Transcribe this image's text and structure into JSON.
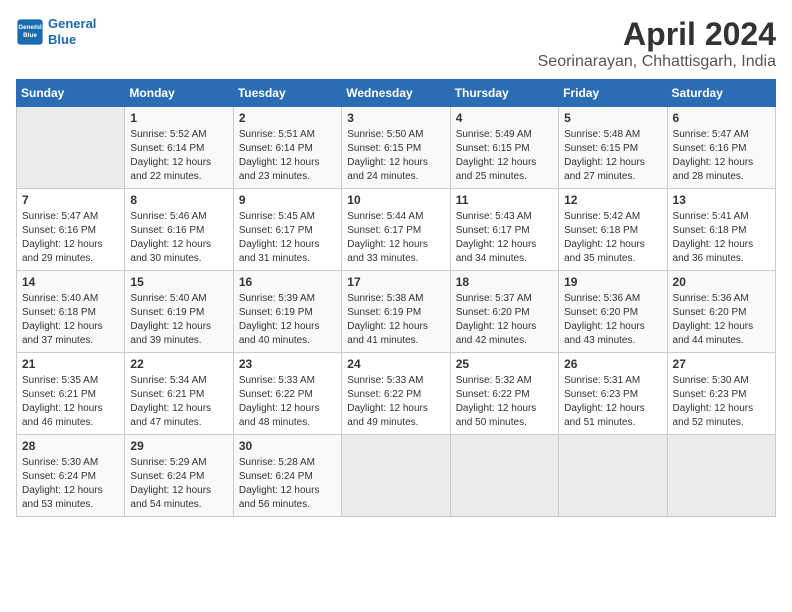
{
  "header": {
    "logo_line1": "General",
    "logo_line2": "Blue",
    "title": "April 2024",
    "subtitle": "Seorinarayan, Chhattisgarh, India"
  },
  "weekdays": [
    "Sunday",
    "Monday",
    "Tuesday",
    "Wednesday",
    "Thursday",
    "Friday",
    "Saturday"
  ],
  "weeks": [
    [
      {
        "day": "",
        "sunrise": "",
        "sunset": "",
        "daylight": ""
      },
      {
        "day": "1",
        "sunrise": "Sunrise: 5:52 AM",
        "sunset": "Sunset: 6:14 PM",
        "daylight": "Daylight: 12 hours and 22 minutes."
      },
      {
        "day": "2",
        "sunrise": "Sunrise: 5:51 AM",
        "sunset": "Sunset: 6:14 PM",
        "daylight": "Daylight: 12 hours and 23 minutes."
      },
      {
        "day": "3",
        "sunrise": "Sunrise: 5:50 AM",
        "sunset": "Sunset: 6:15 PM",
        "daylight": "Daylight: 12 hours and 24 minutes."
      },
      {
        "day": "4",
        "sunrise": "Sunrise: 5:49 AM",
        "sunset": "Sunset: 6:15 PM",
        "daylight": "Daylight: 12 hours and 25 minutes."
      },
      {
        "day": "5",
        "sunrise": "Sunrise: 5:48 AM",
        "sunset": "Sunset: 6:15 PM",
        "daylight": "Daylight: 12 hours and 27 minutes."
      },
      {
        "day": "6",
        "sunrise": "Sunrise: 5:47 AM",
        "sunset": "Sunset: 6:16 PM",
        "daylight": "Daylight: 12 hours and 28 minutes."
      }
    ],
    [
      {
        "day": "7",
        "sunrise": "Sunrise: 5:47 AM",
        "sunset": "Sunset: 6:16 PM",
        "daylight": "Daylight: 12 hours and 29 minutes."
      },
      {
        "day": "8",
        "sunrise": "Sunrise: 5:46 AM",
        "sunset": "Sunset: 6:16 PM",
        "daylight": "Daylight: 12 hours and 30 minutes."
      },
      {
        "day": "9",
        "sunrise": "Sunrise: 5:45 AM",
        "sunset": "Sunset: 6:17 PM",
        "daylight": "Daylight: 12 hours and 31 minutes."
      },
      {
        "day": "10",
        "sunrise": "Sunrise: 5:44 AM",
        "sunset": "Sunset: 6:17 PM",
        "daylight": "Daylight: 12 hours and 33 minutes."
      },
      {
        "day": "11",
        "sunrise": "Sunrise: 5:43 AM",
        "sunset": "Sunset: 6:17 PM",
        "daylight": "Daylight: 12 hours and 34 minutes."
      },
      {
        "day": "12",
        "sunrise": "Sunrise: 5:42 AM",
        "sunset": "Sunset: 6:18 PM",
        "daylight": "Daylight: 12 hours and 35 minutes."
      },
      {
        "day": "13",
        "sunrise": "Sunrise: 5:41 AM",
        "sunset": "Sunset: 6:18 PM",
        "daylight": "Daylight: 12 hours and 36 minutes."
      }
    ],
    [
      {
        "day": "14",
        "sunrise": "Sunrise: 5:40 AM",
        "sunset": "Sunset: 6:18 PM",
        "daylight": "Daylight: 12 hours and 37 minutes."
      },
      {
        "day": "15",
        "sunrise": "Sunrise: 5:40 AM",
        "sunset": "Sunset: 6:19 PM",
        "daylight": "Daylight: 12 hours and 39 minutes."
      },
      {
        "day": "16",
        "sunrise": "Sunrise: 5:39 AM",
        "sunset": "Sunset: 6:19 PM",
        "daylight": "Daylight: 12 hours and 40 minutes."
      },
      {
        "day": "17",
        "sunrise": "Sunrise: 5:38 AM",
        "sunset": "Sunset: 6:19 PM",
        "daylight": "Daylight: 12 hours and 41 minutes."
      },
      {
        "day": "18",
        "sunrise": "Sunrise: 5:37 AM",
        "sunset": "Sunset: 6:20 PM",
        "daylight": "Daylight: 12 hours and 42 minutes."
      },
      {
        "day": "19",
        "sunrise": "Sunrise: 5:36 AM",
        "sunset": "Sunset: 6:20 PM",
        "daylight": "Daylight: 12 hours and 43 minutes."
      },
      {
        "day": "20",
        "sunrise": "Sunrise: 5:36 AM",
        "sunset": "Sunset: 6:20 PM",
        "daylight": "Daylight: 12 hours and 44 minutes."
      }
    ],
    [
      {
        "day": "21",
        "sunrise": "Sunrise: 5:35 AM",
        "sunset": "Sunset: 6:21 PM",
        "daylight": "Daylight: 12 hours and 46 minutes."
      },
      {
        "day": "22",
        "sunrise": "Sunrise: 5:34 AM",
        "sunset": "Sunset: 6:21 PM",
        "daylight": "Daylight: 12 hours and 47 minutes."
      },
      {
        "day": "23",
        "sunrise": "Sunrise: 5:33 AM",
        "sunset": "Sunset: 6:22 PM",
        "daylight": "Daylight: 12 hours and 48 minutes."
      },
      {
        "day": "24",
        "sunrise": "Sunrise: 5:33 AM",
        "sunset": "Sunset: 6:22 PM",
        "daylight": "Daylight: 12 hours and 49 minutes."
      },
      {
        "day": "25",
        "sunrise": "Sunrise: 5:32 AM",
        "sunset": "Sunset: 6:22 PM",
        "daylight": "Daylight: 12 hours and 50 minutes."
      },
      {
        "day": "26",
        "sunrise": "Sunrise: 5:31 AM",
        "sunset": "Sunset: 6:23 PM",
        "daylight": "Daylight: 12 hours and 51 minutes."
      },
      {
        "day": "27",
        "sunrise": "Sunrise: 5:30 AM",
        "sunset": "Sunset: 6:23 PM",
        "daylight": "Daylight: 12 hours and 52 minutes."
      }
    ],
    [
      {
        "day": "28",
        "sunrise": "Sunrise: 5:30 AM",
        "sunset": "Sunset: 6:24 PM",
        "daylight": "Daylight: 12 hours and 53 minutes."
      },
      {
        "day": "29",
        "sunrise": "Sunrise: 5:29 AM",
        "sunset": "Sunset: 6:24 PM",
        "daylight": "Daylight: 12 hours and 54 minutes."
      },
      {
        "day": "30",
        "sunrise": "Sunrise: 5:28 AM",
        "sunset": "Sunset: 6:24 PM",
        "daylight": "Daylight: 12 hours and 56 minutes."
      },
      {
        "day": "",
        "sunrise": "",
        "sunset": "",
        "daylight": ""
      },
      {
        "day": "",
        "sunrise": "",
        "sunset": "",
        "daylight": ""
      },
      {
        "day": "",
        "sunrise": "",
        "sunset": "",
        "daylight": ""
      },
      {
        "day": "",
        "sunrise": "",
        "sunset": "",
        "daylight": ""
      }
    ]
  ]
}
